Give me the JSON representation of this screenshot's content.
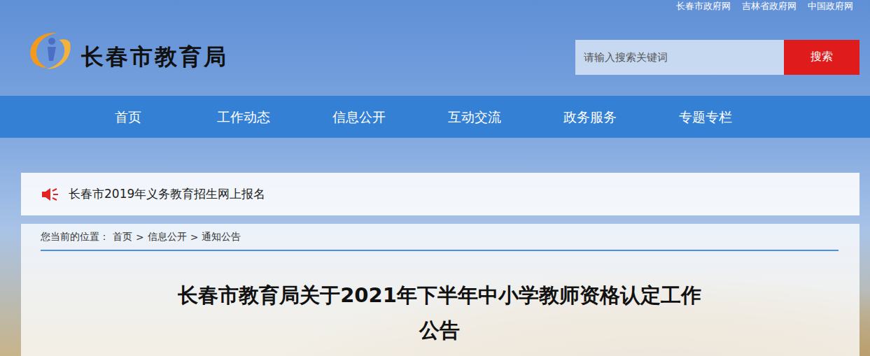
{
  "top_links": [
    "长春市政府网",
    "吉林省政府网",
    "中国政府网"
  ],
  "site": {
    "title": "长春市教育局"
  },
  "search": {
    "placeholder": "请输入搜索关键词",
    "button": "搜索"
  },
  "nav": [
    {
      "label": "首页",
      "selected": false
    },
    {
      "label": "工作动态",
      "selected": false
    },
    {
      "label": "信息公开",
      "selected": false
    },
    {
      "label": "互动交流",
      "selected": false
    },
    {
      "label": "政务服务",
      "selected": false
    },
    {
      "label": "专题专栏",
      "selected": false
    }
  ],
  "notice": {
    "text": "长春市2019年义务教育招生网上报名"
  },
  "breadcrumb": {
    "label": "您当前的位置：",
    "separator": ">",
    "items": [
      "首页",
      "信息公开",
      "通知公告"
    ]
  },
  "article": {
    "title_lines": [
      "长春市教育局关于2021年下半年中小学教师资格认定工作",
      "公告"
    ]
  }
}
